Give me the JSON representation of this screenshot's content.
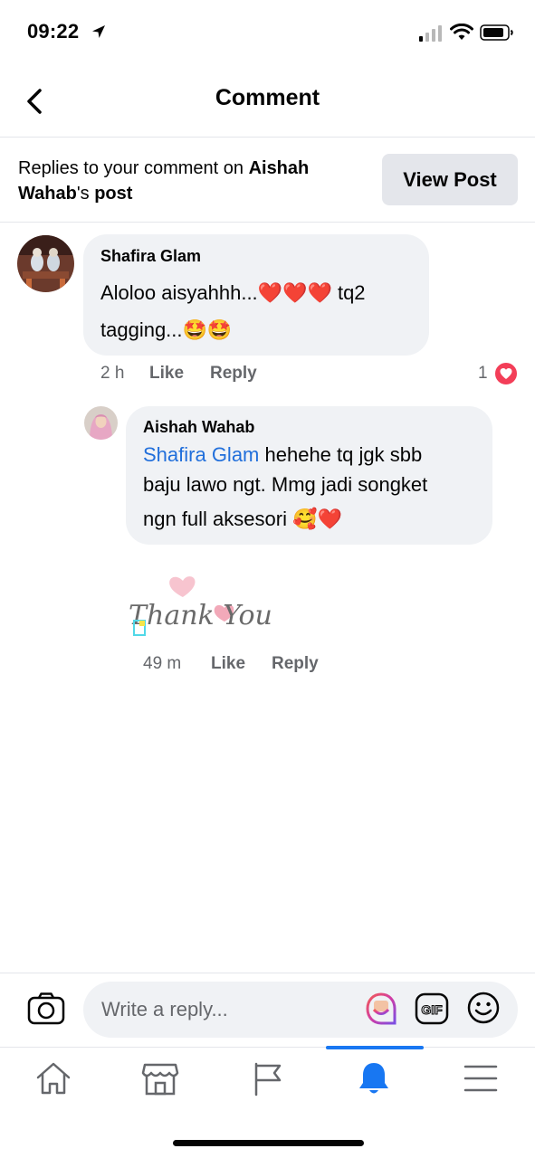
{
  "status_bar": {
    "time": "09:22"
  },
  "header": {
    "title": "Comment",
    "back_icon": "chevron-left-icon"
  },
  "notice": {
    "prefix": "Replies to your comment on ",
    "post_owner": "Aishah Wahab",
    "possessive": "'s ",
    "post_word": "post",
    "view_post_label": "View Post"
  },
  "comments": [
    {
      "author": "Shafira Glam",
      "line1": "Aloloo aisyahhh...❤️❤️❤️ tq2",
      "line2": "tagging...🤩🤩",
      "time": "2 h",
      "like_label": "Like",
      "reply_label": "Reply",
      "reaction_count": "1",
      "reaction_icon": "love-reaction-icon"
    },
    {
      "author": "Aishah Wahab",
      "mention": "Shafira Glam",
      "line1_rest": " hehehe tq jgk sbb",
      "line2": "baju lawo ngt. Mmg jadi songket",
      "line3": "ngn full aksesori 🥰❤️",
      "sticker_text": "Thank You",
      "time": "49 m",
      "like_label": "Like",
      "reply_label": "Reply"
    }
  ],
  "composer": {
    "placeholder": "Write a reply...",
    "gif_label": "GIF"
  },
  "tabs": [
    {
      "name": "home",
      "icon": "home-icon",
      "active": false
    },
    {
      "name": "marketplace",
      "icon": "marketplace-icon",
      "active": false
    },
    {
      "name": "pages",
      "icon": "flag-icon",
      "active": false
    },
    {
      "name": "notifications",
      "icon": "bell-icon",
      "active": true
    },
    {
      "name": "menu",
      "icon": "menu-icon",
      "active": false
    }
  ],
  "colors": {
    "accent": "#1877f2",
    "mention": "#216fdb",
    "bubble": "#f0f2f5",
    "meta": "#65676b",
    "love": "#f33e58"
  }
}
